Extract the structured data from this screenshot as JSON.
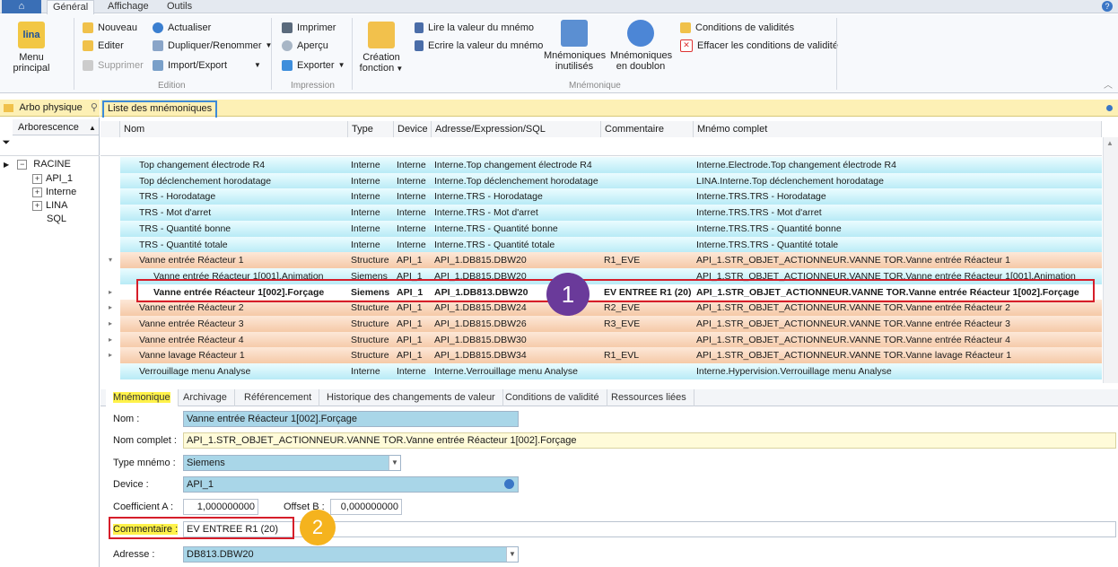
{
  "ribbon_tabs": [
    "Général",
    "Affichage",
    "Outils"
  ],
  "help_glyph": "?",
  "ribbon": {
    "menu_principal": "Menu principal",
    "logo_text": "lina",
    "edition": {
      "nouveau": "Nouveau",
      "editer": "Editer",
      "supprimer": "Supprimer",
      "actualiser": "Actualiser",
      "dupliquer": "Dupliquer/Renommer",
      "import_export": "Import/Export",
      "label": "Edition"
    },
    "impression": {
      "imprimer": "Imprimer",
      "apercu": "Aperçu",
      "exporter": "Exporter",
      "label": "Impression"
    },
    "mnemonique": {
      "creation_line1": "Création",
      "creation_line2": "fonction",
      "lire": "Lire la valeur du mnémo",
      "ecrire": "Ecrire la valeur du mnémo",
      "inutilises_line1": "Mnémoniques",
      "inutilises_line2": "inutilisés",
      "doublon_line1": "Mnémoniques",
      "doublon_line2": "en doublon",
      "conditions": "Conditions de validités",
      "effacer": "Effacer les conditions de validité",
      "label": "Mnémonique"
    }
  },
  "left": {
    "header": "Arbo physique",
    "column": "Arborescence",
    "tree": [
      "RACINE",
      "API_1",
      "Interne",
      "LINA",
      "SQL"
    ]
  },
  "list_title": "Liste des mnémoniques",
  "grid": {
    "columns": [
      "Nom",
      "Type",
      "Device",
      "Adresse/Expression/SQL",
      "Commentaire",
      "Mnémo complet"
    ],
    "rows": [
      {
        "nom": "Top changement électrode R4",
        "type": "Interne",
        "device": "Interne",
        "adresse": "Interne.Top changement électrode R4",
        "commentaire": "",
        "complet": "Interne.Electrode.Top changement électrode R4",
        "style": "cyan",
        "indic": ""
      },
      {
        "nom": "Top déclenchement horodatage",
        "type": "Interne",
        "device": "Interne",
        "adresse": "Interne.Top déclenchement horodatage",
        "commentaire": "",
        "complet": "LINA.Interne.Top déclenchement horodatage",
        "style": "cyan",
        "indic": ""
      },
      {
        "nom": "TRS - Horodatage",
        "type": "Interne",
        "device": "Interne",
        "adresse": "Interne.TRS - Horodatage",
        "commentaire": "",
        "complet": "Interne.TRS.TRS - Horodatage",
        "style": "cyan",
        "indic": ""
      },
      {
        "nom": "TRS - Mot d'arret",
        "type": "Interne",
        "device": "Interne",
        "adresse": "Interne.TRS - Mot d'arret",
        "commentaire": "",
        "complet": "Interne.TRS.TRS - Mot d'arret",
        "style": "cyan",
        "indic": ""
      },
      {
        "nom": "TRS - Quantité bonne",
        "type": "Interne",
        "device": "Interne",
        "adresse": "Interne.TRS - Quantité bonne",
        "commentaire": "",
        "complet": "Interne.TRS.TRS - Quantité bonne",
        "style": "cyan",
        "indic": ""
      },
      {
        "nom": "TRS - Quantité totale",
        "type": "Interne",
        "device": "Interne",
        "adresse": "Interne.TRS - Quantité totale",
        "commentaire": "",
        "complet": "Interne.TRS.TRS - Quantité totale",
        "style": "cyan",
        "indic": ""
      },
      {
        "nom": "Vanne entrée Réacteur 1",
        "type": "Structure",
        "device": "API_1",
        "adresse": "API_1.DB815.DBW20",
        "commentaire": "R1_EVE",
        "complet": "API_1.STR_OBJET_ACTIONNEUR.VANNE TOR.Vanne entrée Réacteur 1",
        "style": "orange",
        "indic": "▾"
      },
      {
        "nom": "Vanne entrée Réacteur 1[001].Animation",
        "type": "Siemens",
        "device": "API_1",
        "adresse": "API_1.DB815.DBW20",
        "commentaire": "",
        "complet": "API_1.STR_OBJET_ACTIONNEUR.VANNE TOR.Vanne entrée Réacteur 1[001].Animation",
        "style": "cyan",
        "indic": "",
        "child": true
      },
      {
        "nom": "Vanne entrée Réacteur 1[002].Forçage",
        "type": "Siemens",
        "device": "API_1",
        "adresse": "API_1.DB813.DBW20",
        "commentaire": "EV ENTREE R1 (20)",
        "complet": "API_1.STR_OBJET_ACTIONNEUR.VANNE TOR.Vanne entrée Réacteur 1[002].Forçage",
        "style": "selrow",
        "indic": "▸",
        "child": true
      },
      {
        "nom": "Vanne entrée Réacteur 2",
        "type": "Structure",
        "device": "API_1",
        "adresse": "API_1.DB815.DBW24",
        "commentaire": "R2_EVE",
        "complet": "API_1.STR_OBJET_ACTIONNEUR.VANNE TOR.Vanne entrée Réacteur 2",
        "style": "orange",
        "indic": "▸"
      },
      {
        "nom": "Vanne entrée Réacteur 3",
        "type": "Structure",
        "device": "API_1",
        "adresse": "API_1.DB815.DBW26",
        "commentaire": "R3_EVE",
        "complet": "API_1.STR_OBJET_ACTIONNEUR.VANNE TOR.Vanne entrée Réacteur 3",
        "style": "orange",
        "indic": "▸"
      },
      {
        "nom": "Vanne entrée Réacteur 4",
        "type": "Structure",
        "device": "API_1",
        "adresse": "API_1.DB815.DBW30",
        "commentaire": "",
        "complet": "API_1.STR_OBJET_ACTIONNEUR.VANNE TOR.Vanne entrée Réacteur 4",
        "style": "orange",
        "indic": "▸"
      },
      {
        "nom": "Vanne lavage Réacteur 1",
        "type": "Structure",
        "device": "API_1",
        "adresse": "API_1.DB815.DBW34",
        "commentaire": "R1_EVL",
        "complet": "API_1.STR_OBJET_ACTIONNEUR.VANNE TOR.Vanne lavage Réacteur 1",
        "style": "orange",
        "indic": "▸"
      },
      {
        "nom": "Verrouillage menu Analyse",
        "type": "Interne",
        "device": "Interne",
        "adresse": "Interne.Verrouillage menu Analyse",
        "commentaire": "",
        "complet": "Interne.Hypervision.Verrouillage menu Analyse",
        "style": "cyan",
        "indic": ""
      }
    ]
  },
  "badge1": "1",
  "badge2": "2",
  "bottom_tabs": [
    "Mnémonique",
    "Archivage",
    "Référencement",
    "Historique des changements de valeur",
    "Conditions de validité",
    "Ressources liées"
  ],
  "details": {
    "nom_label": "Nom :",
    "nom": "Vanne entrée Réacteur 1[002].Forçage",
    "complet_label": "Nom complet :",
    "complet": "API_1.STR_OBJET_ACTIONNEUR.VANNE TOR.Vanne entrée Réacteur 1[002].Forçage",
    "type_label": "Type mnémo :",
    "type": "Siemens",
    "device_label": "Device :",
    "device": "API_1",
    "coefa_label": "Coefficient A :",
    "coefa": "1,000000000",
    "offset_label": "Offset B :",
    "offset": "0,000000000",
    "commentaire_label": "Commentaire :",
    "commentaire": "EV ENTREE R1 (20)",
    "adresse_label": "Adresse :",
    "adresse": "DB813.DBW20"
  }
}
